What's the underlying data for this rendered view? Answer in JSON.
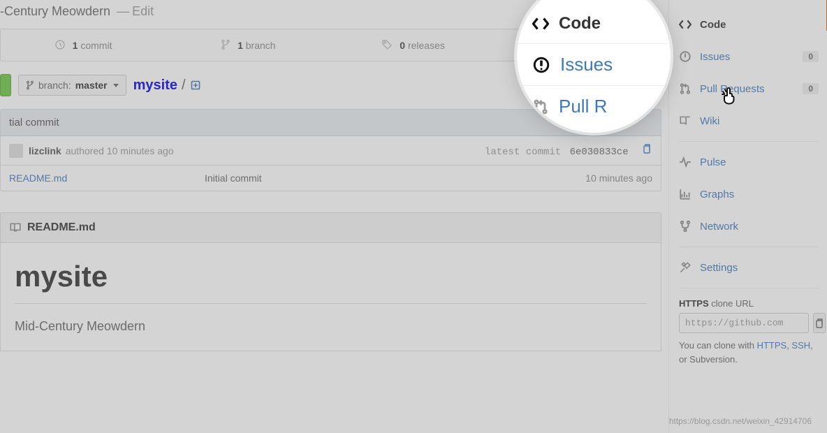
{
  "header": {
    "repo_description_partial": "-Century Meowdern",
    "dash": "—",
    "edit_label": "Edit"
  },
  "stats": {
    "commits": {
      "count": "1",
      "label": "commit"
    },
    "branches": {
      "count": "1",
      "label": "branch"
    },
    "releases": {
      "count": "0",
      "label": "releases"
    }
  },
  "branch_selector": {
    "prefix": "branch:",
    "name": "master"
  },
  "path": {
    "root": "mysite",
    "sep": "/"
  },
  "commit_bar": {
    "title": "tial commit",
    "user": "lizclink",
    "authored": "authored 10 minutes ago",
    "latest_prefix": "latest commit",
    "sha": "6e030833ce"
  },
  "files": [
    {
      "name": "README.md",
      "message": "Initial commit",
      "time": "10 minutes ago"
    }
  ],
  "readme": {
    "panel_title": "README.md",
    "h1": "mysite",
    "subtitle": "Mid-Century Meowdern"
  },
  "sidebar": {
    "code": "Code",
    "issues": {
      "label": "Issues",
      "count": "0"
    },
    "pull_requests": {
      "label": "Pull Requests",
      "count": "0"
    },
    "wiki": "Wiki",
    "pulse": "Pulse",
    "graphs": "Graphs",
    "network": "Network",
    "settings": "Settings"
  },
  "clone": {
    "protocol": "HTTPS",
    "title_suffix": "clone URL",
    "url": "https://github.com",
    "note_prefix": "You can clone with",
    "note_links": [
      "HTTPS",
      "SSH"
    ],
    "note_tail": "or Subversion."
  },
  "spotlight": {
    "code": "Code",
    "issues": "Issues",
    "pull_partial": "Pull R"
  },
  "watermark": "https://blog.csdn.net/weixin_42914706"
}
